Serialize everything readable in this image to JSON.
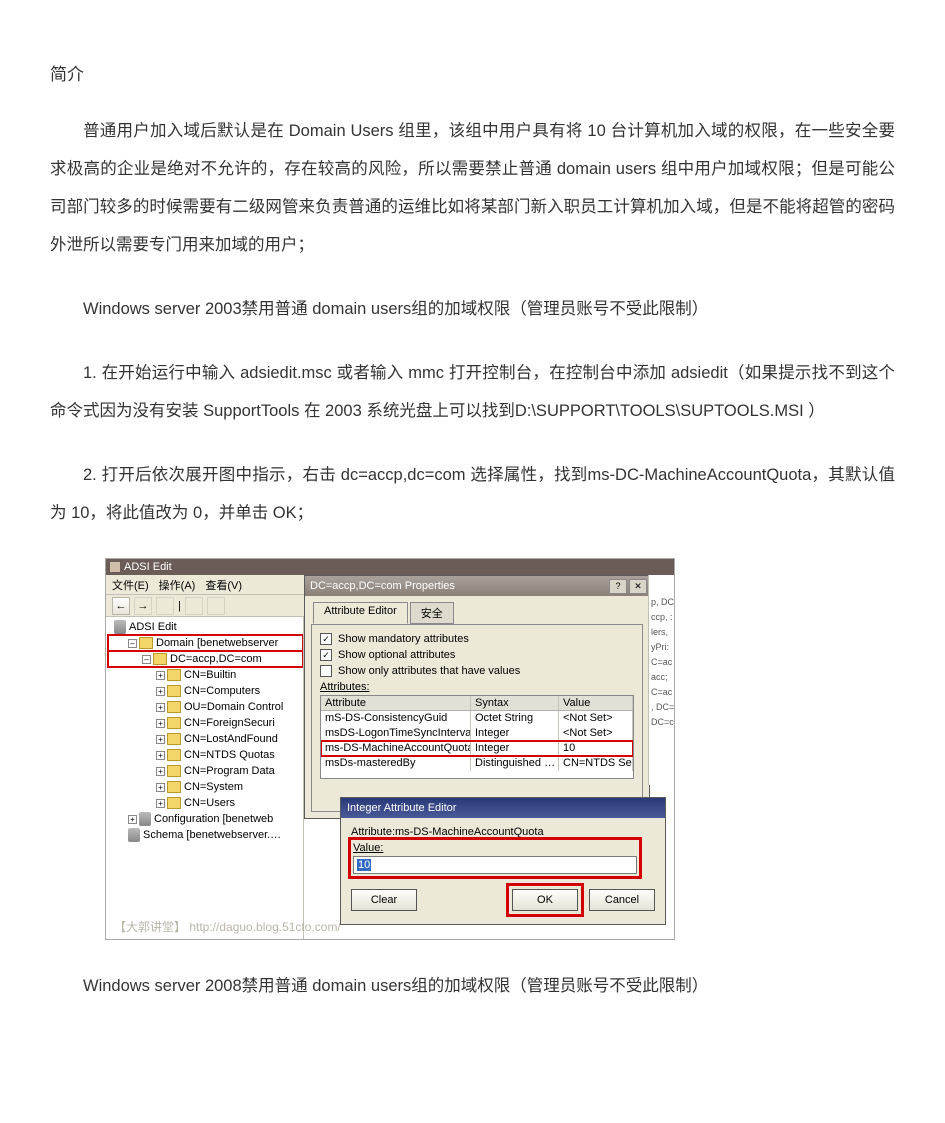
{
  "doc": {
    "title": "简介",
    "p1": "普通用户加入域后默认是在 Domain Users 组里，该组中用户具有将 10 台计算机加入域的权限，在一些安全要求极高的企业是绝对不允许的，存在较高的风险，所以需要禁止普通 domain users 组中用户加域权限；但是可能公司部门较多的时候需要有二级网管来负责普通的运维比如将某部门新入职员工计算机加入域，但是不能将超管的密码外泄所以需要专门用来加域的用户；",
    "p2": "Windows server 2003禁用普通 domain users组的加域权限（管理员账号不受此限制）",
    "p3": "1. 在开始运行中输入 adsiedit.msc 或者输入 mmc 打开控制台，在控制台中添加 adsiedit（如果提示找不到这个命令式因为没有安装 SupportTools 在 2003 系统光盘上可以找到D:\\SUPPORT\\TOOLS\\SUPTOOLS.MSI ）",
    "p4": "2. 打开后依次展开图中指示，右击 dc=accp,dc=com 选择属性，找到ms-DC-MachineAccountQuota，其默认值为 10，将此值改为 0，并单击 OK；",
    "p5": "Windows server 2008禁用普通 domain users组的加域权限（管理员账号不受此限制）"
  },
  "adsi": {
    "titlebar": "ADSI Edit",
    "menu": {
      "file": "文件(E)",
      "action": "操作(A)",
      "view": "查看(V)"
    },
    "tools": {
      "back": "←",
      "fwd": "→",
      "pipe": "|"
    },
    "tree": {
      "root": "ADSI Edit",
      "domain": "Domain [benetwebserver",
      "dc": "DC=accp,DC=com",
      "builtin": "CN=Builtin",
      "computers": "CN=Computers",
      "dcou": "OU=Domain Control",
      "foreign": "CN=ForeignSecuri",
      "lost": "CN=LostAndFound",
      "ntds": "CN=NTDS Quotas",
      "progdata": "CN=Program Data",
      "system": "CN=System",
      "users": "CN=Users",
      "config": "Configuration [benetweb",
      "schema": "Schema [benetwebserver.…"
    },
    "prop": {
      "title": "DC=accp,DC=com Properties",
      "tab1": "Attribute Editor",
      "tab2": "安全",
      "cb1": "Show mandatory attributes",
      "cb2": "Show optional attributes",
      "cb3": "Show only attributes that have values",
      "attrlabel": "Attributes:",
      "hdr": {
        "a": "Attribute",
        "s": "Syntax",
        "v": "Value"
      },
      "rows": [
        {
          "a": "mS-DS-ConsistencyGuid",
          "s": "Octet String",
          "v": "<Not Set>"
        },
        {
          "a": "msDS-LogonTimeSyncInterval",
          "s": "Integer",
          "v": "<Not Set>"
        },
        {
          "a": "ms-DS-MachineAccountQuota",
          "s": "Integer",
          "v": "10"
        },
        {
          "a": "msDs-masteredBy",
          "s": "Distinguished …",
          "v": "CN=NTDS Setting…"
        }
      ]
    },
    "int": {
      "title": "Integer Attribute Editor",
      "attrline": "Attribute:ms-DS-MachineAccountQuota",
      "valuelabel": "Value:",
      "value": "10",
      "clear": "Clear",
      "ok": "OK",
      "cancel": "Cancel"
    },
    "sliver": [
      "p, DC=",
      "ccp, :",
      "lers,",
      "yPri:",
      "C=ac",
      "acc;",
      "C=ac",
      ", DC=",
      "DC=c"
    ],
    "credit": "【大郭讲堂】 http://daguo.blog.51cto.com/"
  }
}
